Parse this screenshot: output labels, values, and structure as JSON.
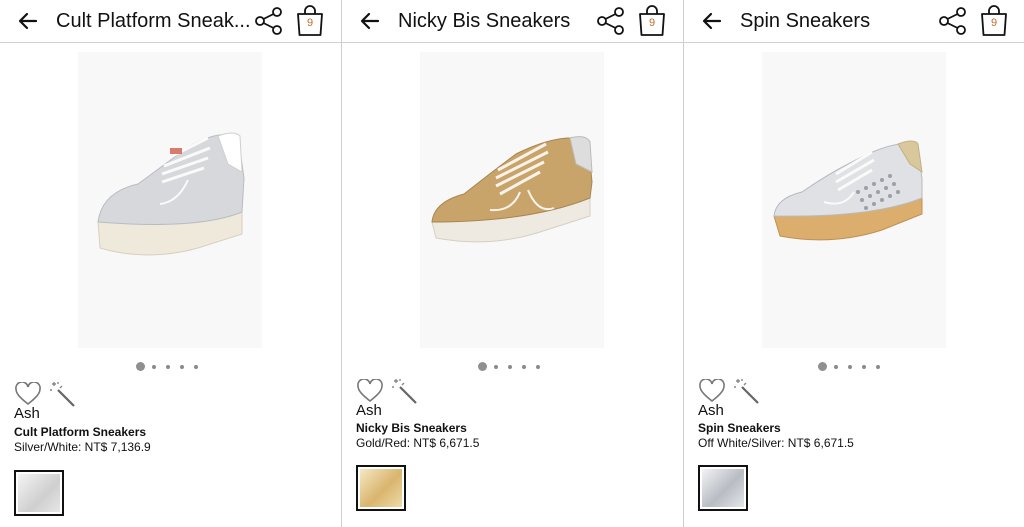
{
  "colors": {
    "bag_count": "#c26b2a",
    "divider": "#cfcfcf"
  },
  "icons": {
    "back": "arrow-left",
    "share": "share",
    "bag": "shopping-bag",
    "favorite": "heart-outline",
    "style": "magic-wand"
  },
  "panels": [
    {
      "title": "Cult Platform Sneak...",
      "bag_count": "9",
      "brand": "Ash",
      "product_name": "Cult Platform Sneakers",
      "color_price": "Silver/White: NT$ 7,136.9",
      "image_index": 1,
      "image_count": 5,
      "swatch_color": "#d9d9d9"
    },
    {
      "title": "Nicky Bis Sneakers",
      "bag_count": "9",
      "brand": "Ash",
      "product_name": "Nicky Bis Sneakers",
      "color_price": "Gold/Red: NT$ 6,671.5",
      "image_index": 1,
      "image_count": 5,
      "swatch_color": "#e3c68a"
    },
    {
      "title": "Spin Sneakers",
      "bag_count": "9",
      "brand": "Ash",
      "product_name": "Spin Sneakers",
      "color_price": "Off White/Silver: NT$ 6,671.5",
      "image_index": 1,
      "image_count": 5,
      "swatch_color": "#c4c8cf"
    }
  ]
}
